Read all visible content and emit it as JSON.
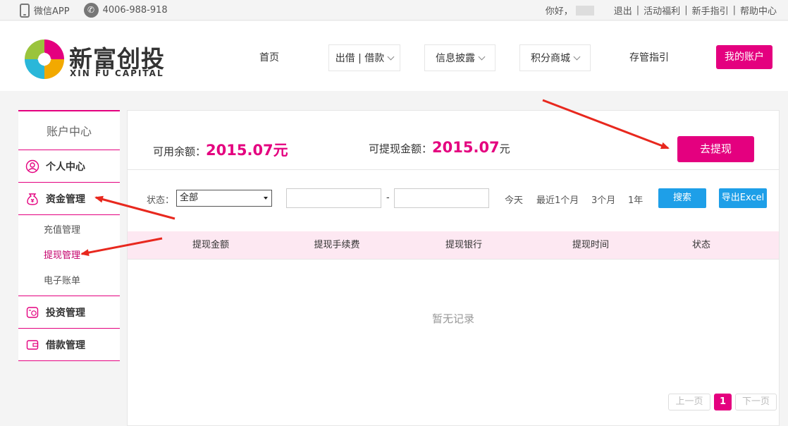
{
  "topbar": {
    "wechat_app": "微信APP",
    "phone": "4006-988-918",
    "greeting": "你好，",
    "links": [
      "退出",
      "活动福利",
      "新手指引",
      "帮助中心"
    ],
    "separator": "|"
  },
  "header": {
    "logo_cn": "新富创投",
    "logo_en": "XIN FU CAPITAL",
    "nav": {
      "home": "首页",
      "lend_borrow": "出借 | 借款",
      "disclosure": "信息披露",
      "points_mall": "积分商城",
      "custody_guide": "存管指引"
    },
    "my_account": "我的账户"
  },
  "sidebar": {
    "title": "账户中心",
    "personal_center": "个人中心",
    "fund_management": "资金管理",
    "sub_items": [
      "充值管理",
      "提现管理",
      "电子账单"
    ],
    "investment_management": "投资管理",
    "loan_management": "借款管理"
  },
  "main": {
    "available_label": "可用余额：",
    "available_amount": "2015.07元",
    "withdrawable_label": "可提现金额：",
    "withdrawable_amount": "2015.07",
    "withdrawable_unit": "元",
    "withdraw_button": "去提现",
    "filter": {
      "status_label": "状态：",
      "status_value": "全部",
      "date_dash": "-",
      "quick_ranges": [
        "今天",
        "最近1个月",
        "3个月",
        "1年"
      ],
      "search_button": "搜索",
      "export_button": "导出Excel"
    },
    "table": {
      "columns": [
        "提现金额",
        "提现手续费",
        "提现银行",
        "提现时间",
        "状态"
      ],
      "empty_text": "暂无记录"
    },
    "pagination": {
      "prev": "上一页",
      "current": "1",
      "next": "下一页"
    }
  },
  "colors": {
    "brand": "#e4007f",
    "button_blue": "#1e9fe8",
    "header_row": "#fde8f2",
    "annotation_arrow": "#e8281e"
  }
}
